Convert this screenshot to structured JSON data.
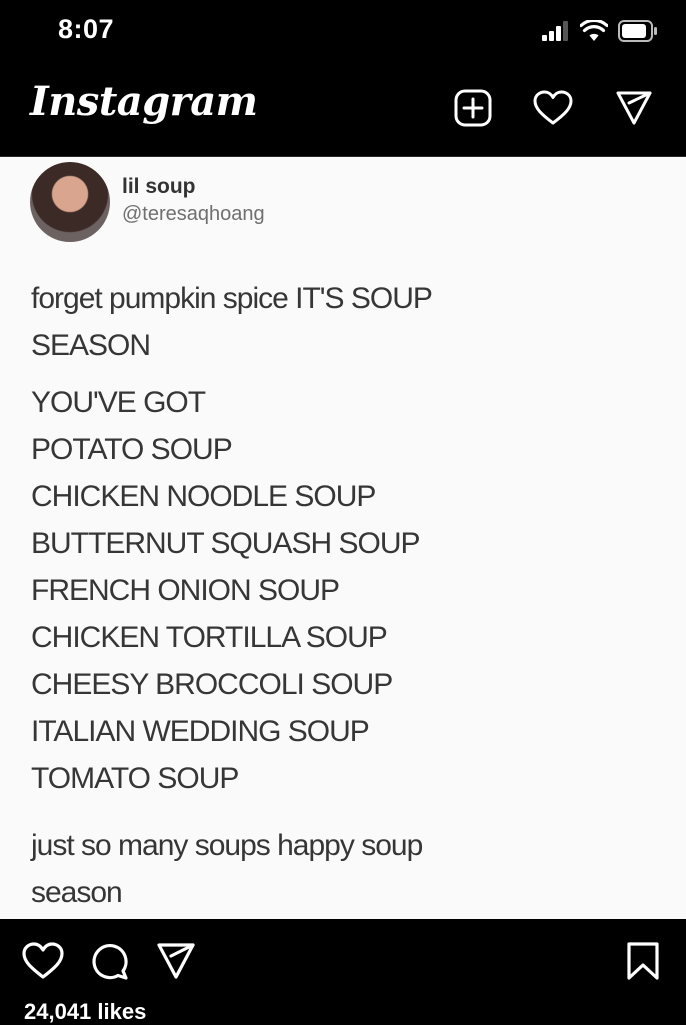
{
  "status_bar": {
    "time": "8:07",
    "icons": [
      "cellular-signal-icon",
      "wifi-icon",
      "battery-icon"
    ]
  },
  "header": {
    "logo_text": "Instagram",
    "icons": [
      "new-post-icon",
      "activity-heart-icon",
      "direct-message-icon"
    ]
  },
  "post": {
    "tweet": {
      "display_name": "lil soup",
      "handle": "@teresaqhoang",
      "intro": "forget pumpkin spice IT'S SOUP SEASON",
      "list": [
        "YOU'VE GOT",
        "POTATO SOUP",
        "CHICKEN NOODLE SOUP",
        "BUTTERNUT SQUASH SOUP",
        "FRENCH ONION SOUP",
        "CHICKEN TORTILLA SOUP",
        "CHEESY BROCCOLI SOUP",
        "ITALIAN WEDDING SOUP",
        "TOMATO SOUP"
      ],
      "outro": "just so many soups happy soup season"
    }
  },
  "actions": {
    "icons": [
      "like-heart-icon",
      "comment-icon",
      "share-icon",
      "save-bookmark-icon"
    ],
    "likes": "24,041 likes"
  },
  "colors": {
    "background": "#000000",
    "post_background": "#fafafa",
    "tweet_text": "#363636",
    "handle_text": "#6f6f6f"
  }
}
